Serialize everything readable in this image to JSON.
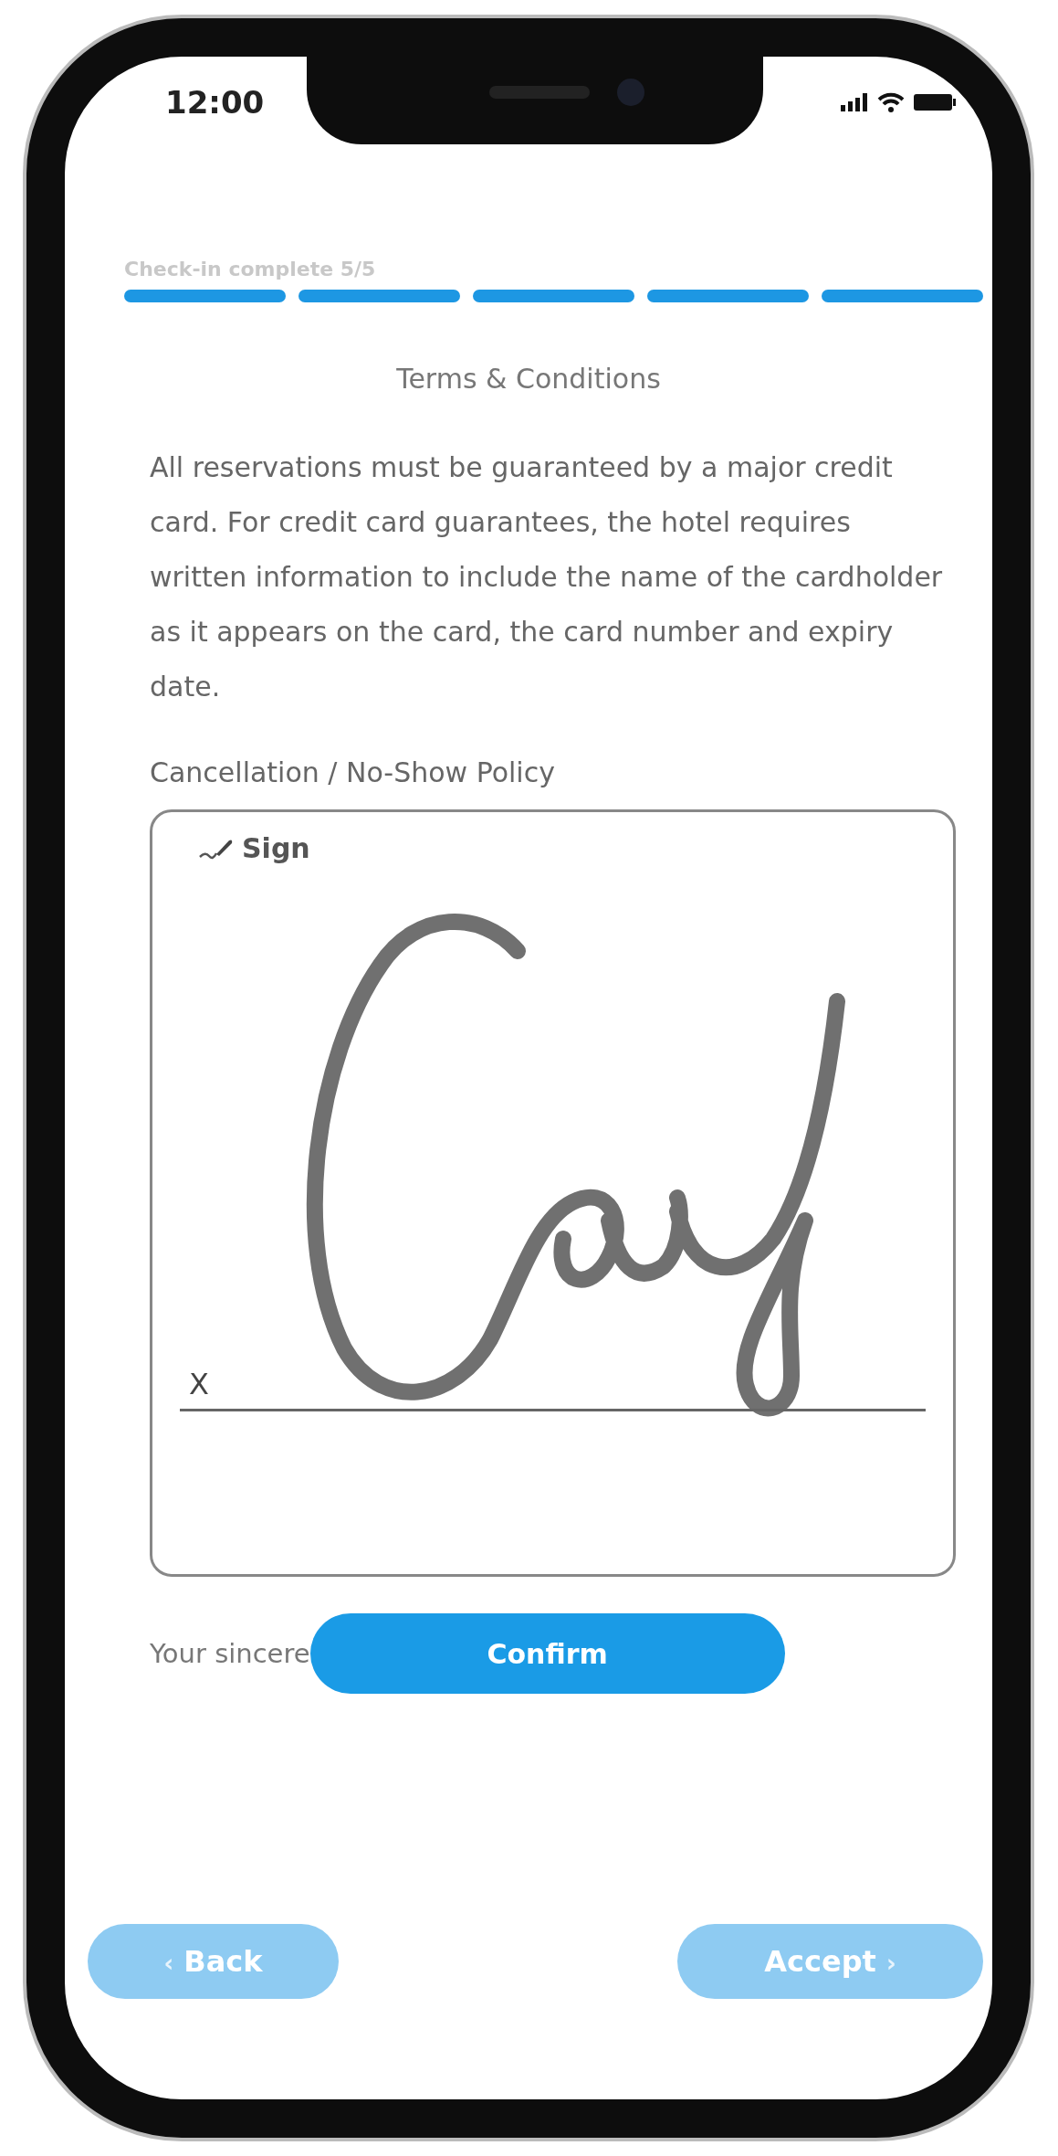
{
  "status_bar": {
    "time": "12:00"
  },
  "progress": {
    "label": "Check-in complete 5/5",
    "steps": [
      {
        "done": true
      },
      {
        "done": true
      },
      {
        "done": true
      },
      {
        "done": true
      },
      {
        "done": true
      }
    ]
  },
  "title": "Terms & Conditions",
  "paragraphs": [
    {
      "kind": "body",
      "text": "All reservations must be guaranteed by a major credit card. For credit card guarantees, the hotel requires written information to include the name of the cardholder as it appears on the card, the card number and expiry date."
    },
    {
      "kind": "heading",
      "text": "Cancellation / No-Show Policy"
    }
  ],
  "sign_dialog": {
    "title": "Sign",
    "line_mark": "X"
  },
  "closing": "Your sincere",
  "confirm_button": "Confirm",
  "nav": {
    "back": {
      "label": "Back",
      "arrow": "‹",
      "disabled": true
    },
    "accept": {
      "label": "Accept",
      "arrow": "›",
      "disabled": true
    }
  }
}
